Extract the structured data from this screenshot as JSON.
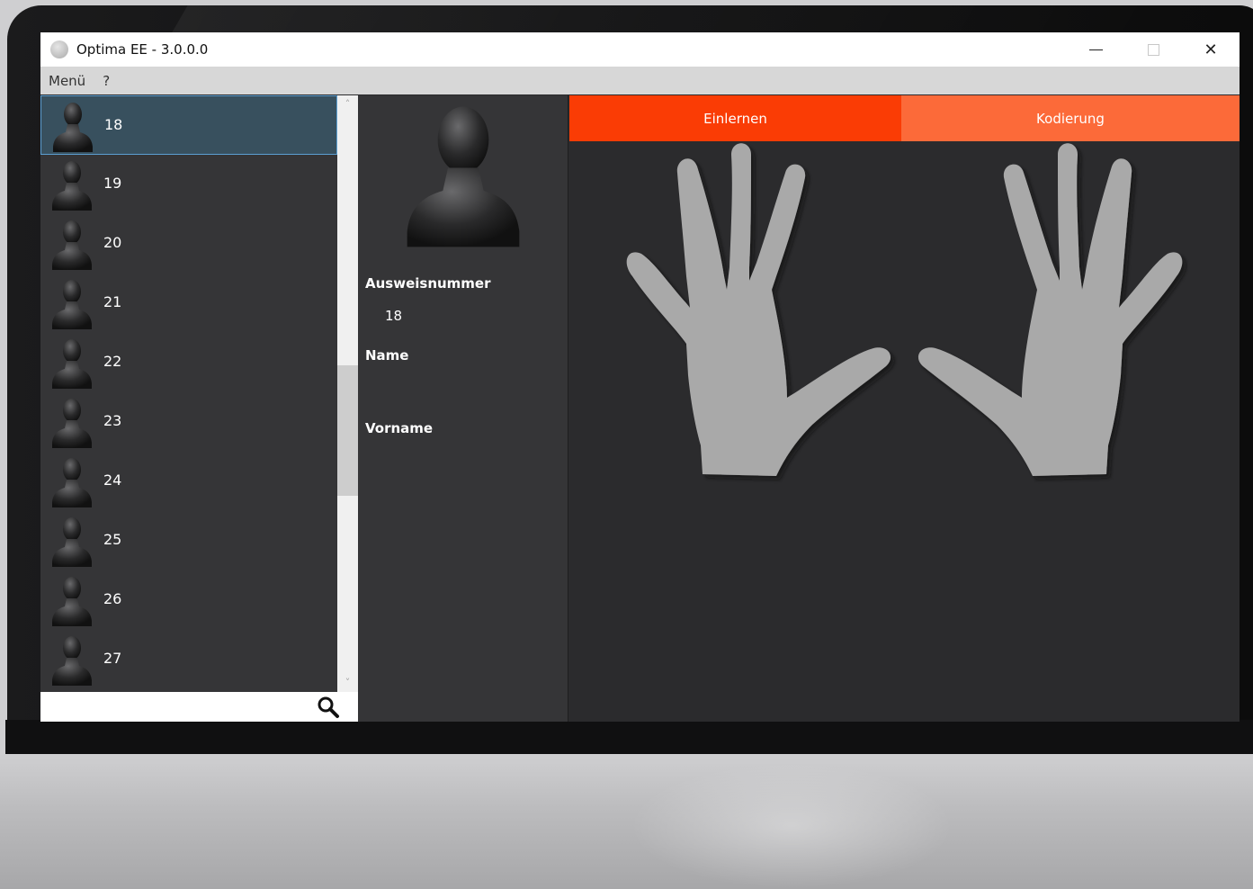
{
  "window": {
    "title": "Optima EE - 3.0.0.0"
  },
  "window_controls": {
    "minimize": "",
    "maximize": "",
    "close": "✕"
  },
  "menu": {
    "items": [
      "Menü",
      "?"
    ]
  },
  "user_list": {
    "items": [
      {
        "label": "18",
        "selected": true
      },
      {
        "label": "19"
      },
      {
        "label": "20"
      },
      {
        "label": "21"
      },
      {
        "label": "22"
      },
      {
        "label": "23"
      },
      {
        "label": "24"
      },
      {
        "label": "25"
      },
      {
        "label": "26"
      },
      {
        "label": "27"
      }
    ]
  },
  "search": {
    "value": "",
    "placeholder": ""
  },
  "scrollbar": {
    "up": "˄",
    "down": "˅"
  },
  "details": {
    "id_label": "Ausweisnummer",
    "id_value": "18",
    "name_label": "Name",
    "name_value": "",
    "firstname_label": "Vorname",
    "firstname_value": ""
  },
  "tabs": {
    "enroll": "Einlernen",
    "encoding": "Kodierung"
  },
  "colors": {
    "tab_active": "#fa3c05",
    "tab_secondary": "#fc6a39",
    "selected_row": "#38505e",
    "selected_border": "#5c9fd2",
    "hand_fill": "#a9a9a9"
  }
}
